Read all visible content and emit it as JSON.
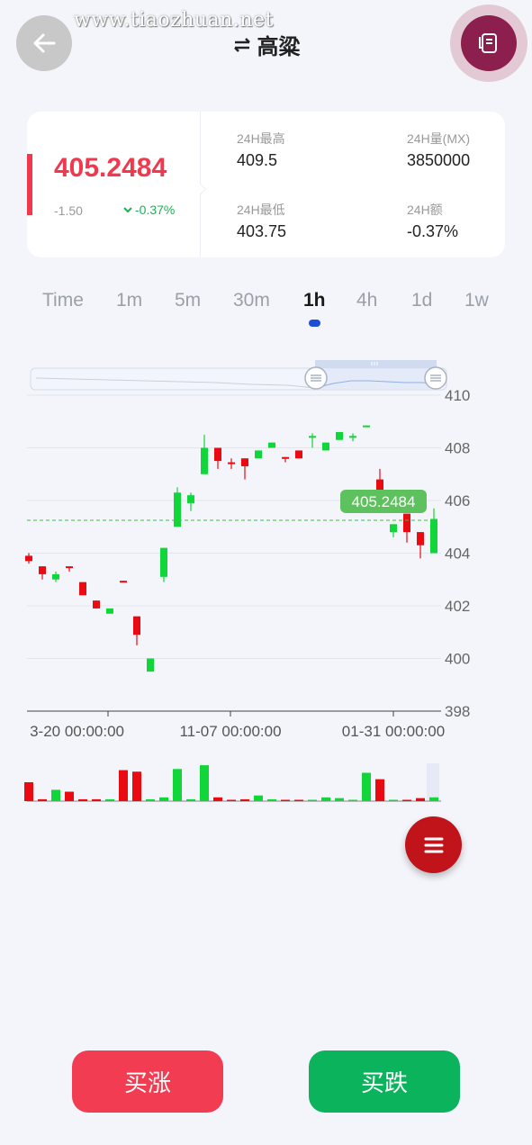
{
  "watermark": "www.tiaozhuan.net",
  "header": {
    "title": "高粱",
    "swap_icon": "swap-arrows-icon",
    "back_icon": "arrow-left-icon",
    "orders_icon": "document-icon"
  },
  "ticker": {
    "price": "405.2484",
    "change": "-1.50",
    "change_pct": "-0.37%",
    "high_label": "24H最高",
    "high_value": "409.5",
    "volume_label": "24H量(MX)",
    "volume_value": "3850000",
    "low_label": "24H最低",
    "low_value": "403.75",
    "amount_label": "24H额",
    "amount_value": "-0.37%",
    "colors": {
      "up": "#f0394f",
      "down": "#18b255"
    }
  },
  "tabs": [
    "Time",
    "1m",
    "5m",
    "30m",
    "1h",
    "4h",
    "1d",
    "1w"
  ],
  "active_tab": "1h",
  "chart_data": {
    "type": "candlestick",
    "y_ticks": [
      "410",
      "408",
      "406",
      "404",
      "402",
      "400",
      "398"
    ],
    "ylim": [
      398,
      410
    ],
    "x_ticks": [
      "3-20 00:00:00",
      "11-07 00:00:00",
      "01-31 00:00:00"
    ],
    "current_price_label": "405.2484",
    "current_price": 405.25,
    "candles": [
      {
        "o": 403.9,
        "c": 403.7,
        "h": 404.0,
        "l": 403.6
      },
      {
        "o": 403.5,
        "c": 403.2,
        "h": 403.5,
        "l": 403.0
      },
      {
        "o": 403.0,
        "c": 403.2,
        "h": 403.3,
        "l": 402.9
      },
      {
        "o": 403.5,
        "c": 403.45,
        "h": 403.5,
        "l": 403.3
      },
      {
        "o": 402.9,
        "c": 402.4,
        "h": 402.9,
        "l": 402.4
      },
      {
        "o": 402.2,
        "c": 401.9,
        "h": 402.2,
        "l": 401.9
      },
      {
        "o": 401.7,
        "c": 401.9,
        "h": 401.9,
        "l": 401.7
      },
      {
        "o": 402.95,
        "c": 402.9,
        "h": 402.95,
        "l": 402.9
      },
      {
        "o": 401.6,
        "c": 400.9,
        "h": 401.6,
        "l": 400.5
      },
      {
        "o": 399.5,
        "c": 400.0,
        "h": 400.0,
        "l": 399.5
      },
      {
        "o": 403.1,
        "c": 404.2,
        "h": 404.2,
        "l": 402.9
      },
      {
        "o": 405.0,
        "c": 406.3,
        "h": 406.5,
        "l": 405.0
      },
      {
        "o": 405.9,
        "c": 406.2,
        "h": 406.3,
        "l": 405.6
      },
      {
        "o": 407.0,
        "c": 408.0,
        "h": 408.5,
        "l": 407.0
      },
      {
        "o": 408.0,
        "c": 407.5,
        "h": 408.0,
        "l": 407.2
      },
      {
        "o": 407.45,
        "c": 407.4,
        "h": 407.6,
        "l": 407.2
      },
      {
        "o": 407.6,
        "c": 407.3,
        "h": 407.6,
        "l": 406.8
      },
      {
        "o": 407.6,
        "c": 407.9,
        "h": 407.9,
        "l": 407.6
      },
      {
        "o": 408.0,
        "c": 408.2,
        "h": 408.2,
        "l": 408.0
      },
      {
        "o": 407.65,
        "c": 407.6,
        "h": 407.65,
        "l": 407.45
      },
      {
        "o": 407.9,
        "c": 407.6,
        "h": 407.9,
        "l": 407.6
      },
      {
        "o": 408.4,
        "c": 408.45,
        "h": 408.55,
        "l": 408.0
      },
      {
        "o": 407.9,
        "c": 408.2,
        "h": 408.2,
        "l": 407.9
      },
      {
        "o": 408.3,
        "c": 408.6,
        "h": 408.6,
        "l": 408.3
      },
      {
        "o": 408.45,
        "c": 408.45,
        "h": 408.55,
        "l": 408.25
      },
      {
        "o": 408.8,
        "c": 408.85,
        "h": 408.85,
        "l": 408.8
      },
      {
        "o": 406.8,
        "c": 406.3,
        "h": 407.2,
        "l": 406.2
      },
      {
        "o": 404.8,
        "c": 405.1,
        "h": 405.1,
        "l": 404.6
      },
      {
        "o": 405.5,
        "c": 404.8,
        "h": 405.5,
        "l": 404.4
      },
      {
        "o": 404.8,
        "c": 404.3,
        "h": 404.8,
        "l": 403.8
      },
      {
        "o": 404.0,
        "c": 405.3,
        "h": 405.7,
        "l": 404.0
      }
    ],
    "volumes": [
      0.5,
      0.05,
      0.3,
      0.25,
      0.05,
      0.05,
      0.05,
      0.82,
      0.78,
      0.05,
      0.1,
      0.85,
      0.05,
      0.95,
      0.1,
      0.03,
      0.05,
      0.15,
      0.05,
      0.03,
      0.03,
      0.03,
      0.1,
      0.08,
      0.03,
      0.75,
      0.58,
      0.03,
      0.03,
      0.08,
      0.1
    ]
  },
  "actions": {
    "buy_up": "买涨",
    "buy_down": "买跌",
    "menu_icon": "menu-icon"
  }
}
